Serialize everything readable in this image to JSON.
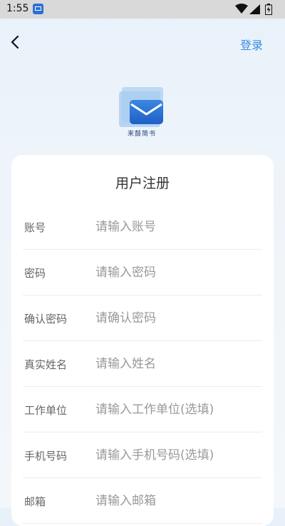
{
  "status_bar": {
    "time": "1:55",
    "icons": [
      "app-notification-icon",
      "wifi-icon",
      "signal-icon",
      "battery-icon"
    ]
  },
  "nav": {
    "back_icon": "chevron-left-icon",
    "login_label": "登录"
  },
  "logo": {
    "text": "来鼓简书"
  },
  "form": {
    "title": "用户注册",
    "fields": [
      {
        "label": "账号",
        "placeholder": "请输入账号",
        "value": ""
      },
      {
        "label": "密码",
        "placeholder": "请输入密码",
        "value": ""
      },
      {
        "label": "确认密码",
        "placeholder": "请确认密码",
        "value": ""
      },
      {
        "label": "真实姓名",
        "placeholder": "请输入姓名",
        "value": ""
      },
      {
        "label": "工作单位",
        "placeholder": "请输入工作单位(选填)",
        "value": ""
      },
      {
        "label": "手机号码",
        "placeholder": "请输入手机号码(选填)",
        "value": ""
      },
      {
        "label": "邮箱",
        "placeholder": "请输入邮箱",
        "value": ""
      }
    ]
  },
  "colors": {
    "accent": "#3a8de0",
    "background": "#eef4fa",
    "card": "#ffffff",
    "label": "#666666",
    "placeholder": "#999999"
  }
}
